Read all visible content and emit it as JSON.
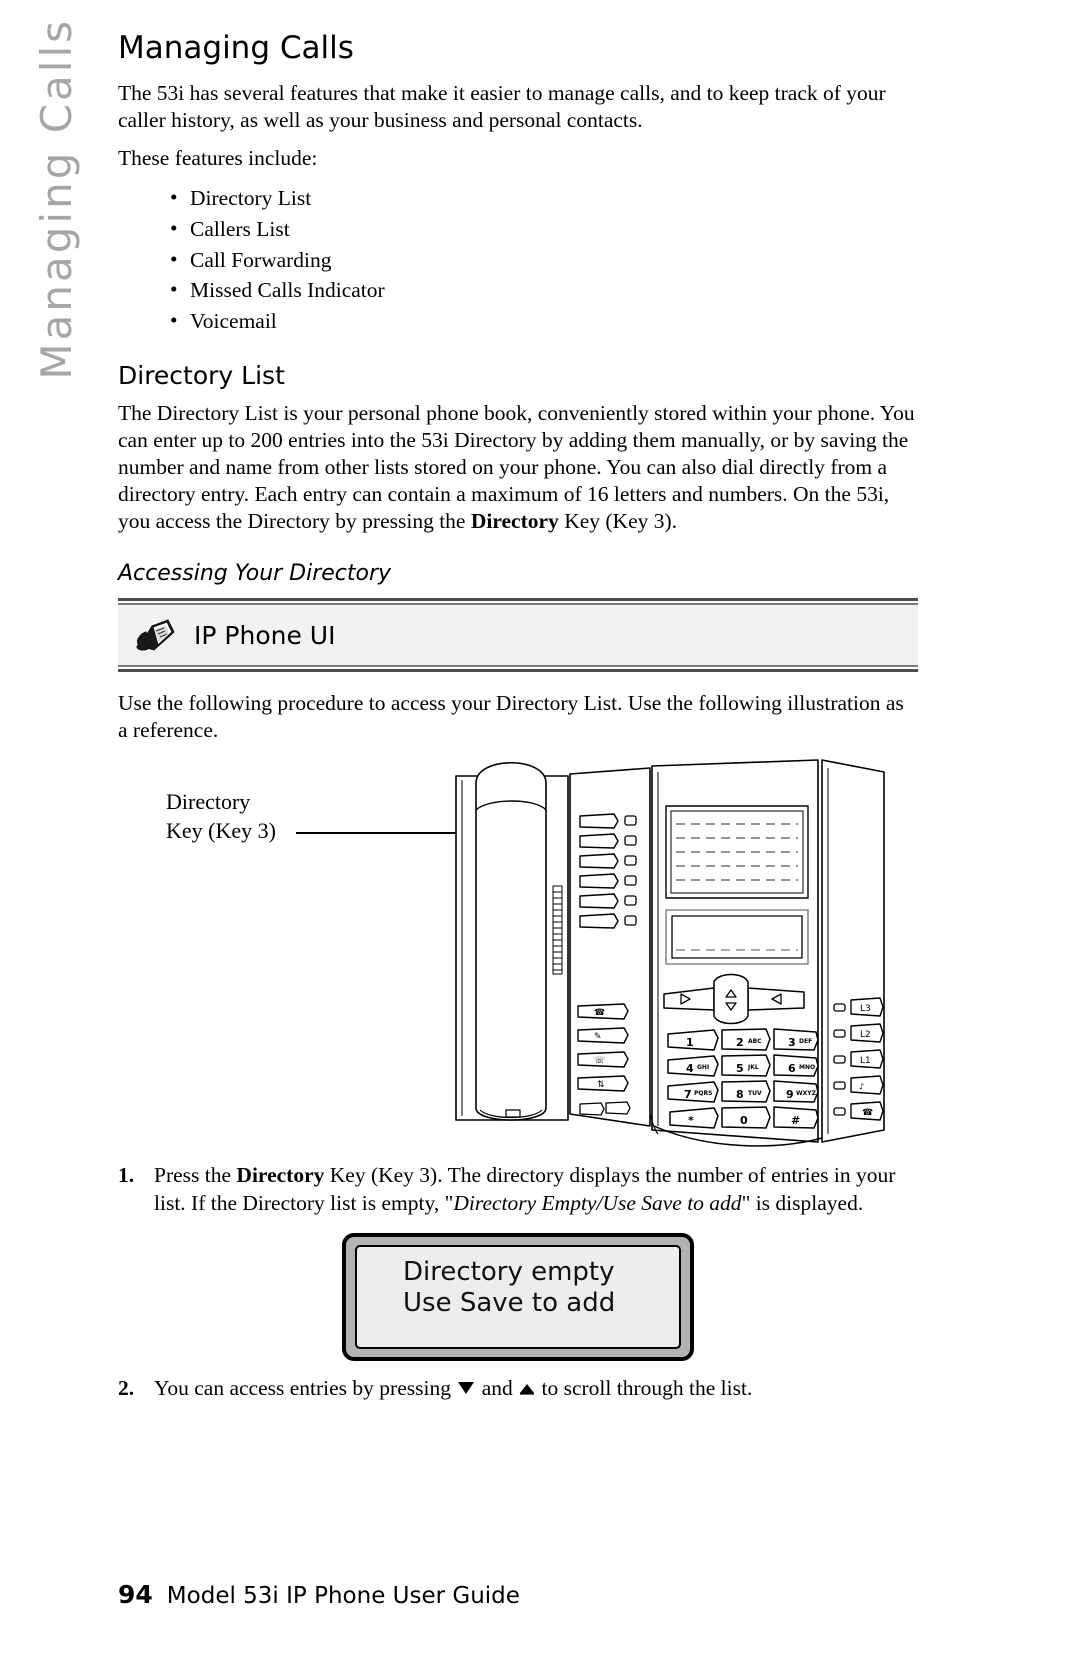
{
  "margin_tab": {
    "label": "Managing Calls",
    "color": "#a6a6a6"
  },
  "page": {
    "title": "Managing Calls",
    "intro": "The 53i has several features that make it easier to manage calls, and to keep track of your caller history, as well as your business and personal contacts.",
    "features_lead": "These features include:",
    "features": [
      "Directory List",
      "Callers List",
      "Call Forwarding",
      "Missed Calls Indicator",
      "Voicemail"
    ]
  },
  "directory_section": {
    "heading": "Directory List",
    "paragraph_part1": "The Directory List is your personal phone book, conveniently stored within your phone. You can enter up to 200 entries into the 53i Directory by adding them manually, or by saving the number and name from other lists stored on your phone. You can also dial directly from a directory entry. Each entry can contain a maximum of 16 letters and numbers. On the 53i, you access the Directory by pressing the ",
    "paragraph_bold": "Directory",
    "paragraph_part2": " Key (Key 3).",
    "subheading": "Accessing Your Directory"
  },
  "ui_banner": {
    "label": "IP Phone UI",
    "icon": "ip-phone-icon",
    "background": "#f2f2f2",
    "rule_color": "#4d4d4d"
  },
  "procedure_intro": "Use the following procedure to access your Directory List. Use the following illustration as a reference.",
  "illustration": {
    "callout_line1": "Directory",
    "callout_line2": "Key (Key 3)",
    "keypad_rows": [
      [
        "1",
        "2 ABC",
        "3 DEF"
      ],
      [
        "4 GHI",
        "5 JKL",
        "6 MNO"
      ],
      [
        "7 PQRS",
        "8 TUV",
        "9 WXYZ"
      ],
      [
        "*",
        "0",
        "#"
      ]
    ],
    "line_keys": [
      "L3",
      "L2",
      "L1"
    ],
    "feature_keys": [
      "goodbye-key",
      "options-key",
      "hold-key",
      "transfer-key"
    ],
    "nav_keys": [
      "left-arrow",
      "up-arrow",
      "down-arrow",
      "right-arrow"
    ]
  },
  "steps": [
    {
      "num": "1.",
      "text_part1": "Press the ",
      "bold1": "Directory",
      "text_part2": " Key (Key 3). The directory displays the number of entries in your list. If the Directory list is empty, \"",
      "italic1": "Directory Empty/Use Save to add",
      "text_part3": "\" is displayed."
    },
    {
      "num": "2.",
      "text_part1": "You can access entries by pressing ",
      "icon1": "down-arrow-icon",
      "text_part2": " and ",
      "icon2": "up-arrow-icon",
      "text_part3": " to scroll through the list."
    }
  ],
  "lcd_display": {
    "line1": "Directory empty",
    "line2": "Use Save to add",
    "screen_color": "#ededed",
    "bezel_color": "#b3b3b3"
  },
  "footer": {
    "page_number": "94",
    "guide_title": "Model 53i IP Phone User Guide"
  }
}
